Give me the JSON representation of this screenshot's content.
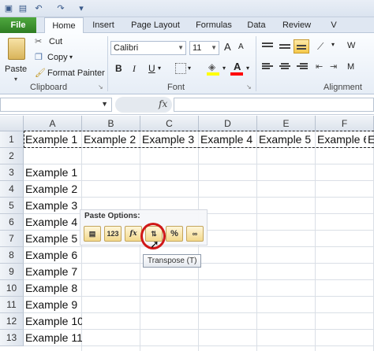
{
  "ribbon_tabs": {
    "file": "File",
    "home": "Home",
    "insert": "Insert",
    "page_layout": "Page Layout",
    "formulas": "Formulas",
    "data": "Data",
    "review": "Review",
    "view": "V"
  },
  "clipboard": {
    "paste": "Paste",
    "cut": "Cut",
    "copy": "Copy",
    "format_painter": "Format Painter",
    "group_label": "Clipboard"
  },
  "font": {
    "font_name": "Calibri",
    "font_size": "11",
    "bold": "B",
    "italic": "I",
    "underline": "U",
    "grow": "A",
    "shrink": "A",
    "group_label": "Font",
    "fill_color": "#ffff00",
    "text_color": "#ff0000"
  },
  "alignment": {
    "group_label": "Alignment",
    "wrap_partial": "W",
    "merge_partial": "M"
  },
  "formula_bar": {
    "fx": "fx"
  },
  "columns": [
    "A",
    "B",
    "C",
    "D",
    "E",
    "F"
  ],
  "rows": [
    "1",
    "2",
    "3",
    "4",
    "5",
    "6",
    "7",
    "8",
    "9",
    "10",
    "11",
    "12",
    "13"
  ],
  "row1_cells": [
    "Example 1",
    "Example 2",
    "Example 3",
    "Example 4",
    "Example 5",
    "Example 6",
    "E"
  ],
  "colA_cells": [
    "Example 1",
    "Example 2",
    "Example 3",
    "Example 4",
    "Example 5",
    "Example 6",
    "Example 7",
    "Example 8",
    "Example 9",
    "Example 10",
    "Example 11"
  ],
  "paste_options": {
    "title": "Paste Options:",
    "tooltip": "Transpose (T)",
    "values_icon": "123",
    "formulas_icon": "fx",
    "percent_icon": "%"
  },
  "colors": {
    "file_tab": "#3a8f2e",
    "highlight_ring": "#d01818"
  }
}
